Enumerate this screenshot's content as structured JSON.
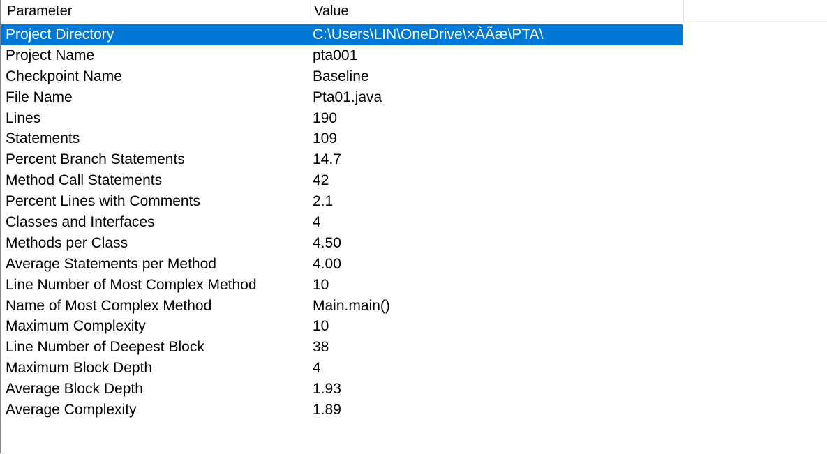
{
  "columns": {
    "parameter": "Parameter",
    "value": "Value"
  },
  "selected_index": 0,
  "rows": [
    {
      "parameter": "Project Directory",
      "value": "C:\\Users\\LIN\\OneDrive\\×ÀÃæ\\PTA\\"
    },
    {
      "parameter": "Project Name",
      "value": "pta001"
    },
    {
      "parameter": "Checkpoint Name",
      "value": "Baseline"
    },
    {
      "parameter": "File Name",
      "value": "Pta01.java"
    },
    {
      "parameter": "Lines",
      "value": "190"
    },
    {
      "parameter": "Statements",
      "value": "109"
    },
    {
      "parameter": "Percent Branch Statements",
      "value": "14.7"
    },
    {
      "parameter": "Method Call Statements",
      "value": "42"
    },
    {
      "parameter": "Percent Lines with Comments",
      "value": "2.1"
    },
    {
      "parameter": "Classes and Interfaces",
      "value": "4"
    },
    {
      "parameter": "Methods per Class",
      "value": "4.50"
    },
    {
      "parameter": "Average Statements per Method",
      "value": "4.00"
    },
    {
      "parameter": "Line Number of Most Complex Method",
      "value": "10"
    },
    {
      "parameter": "Name of Most Complex Method",
      "value": "Main.main()"
    },
    {
      "parameter": "Maximum Complexity",
      "value": "10"
    },
    {
      "parameter": "Line Number of Deepest Block",
      "value": "38"
    },
    {
      "parameter": "Maximum Block Depth",
      "value": "4"
    },
    {
      "parameter": "Average Block Depth",
      "value": "1.93"
    },
    {
      "parameter": "Average Complexity",
      "value": "1.89"
    }
  ]
}
